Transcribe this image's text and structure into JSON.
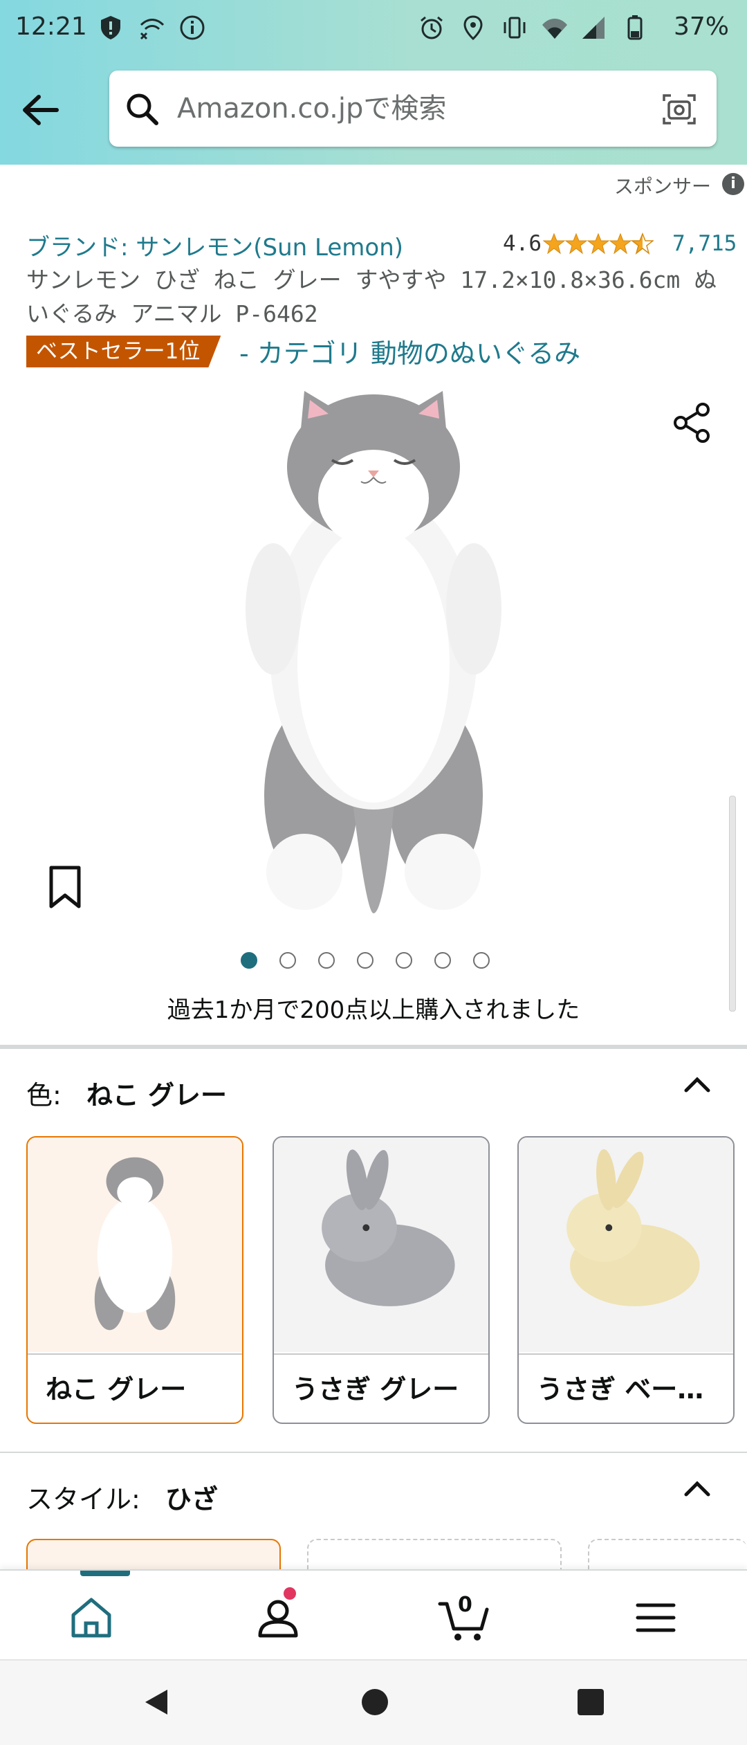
{
  "status_bar": {
    "time": "12:21",
    "battery": "37%"
  },
  "search": {
    "placeholder": "Amazon.co.jpで検索"
  },
  "sponsor": {
    "label": "スポンサー"
  },
  "product": {
    "brand": "ブランド: サンレモン(Sun Lemon)",
    "rating": "4.6",
    "rating_stars": 4.5,
    "rating_count": "7,715",
    "title": "サンレモン ひざ ねこ グレー すやすや 17.2×10.8×36.6cm ぬいぐるみ アニマル P-6462",
    "badge": "ベストセラー1位",
    "category": "- カテゴリ 動物のぬいぐるみ",
    "image_count": 7,
    "active_image": 1,
    "bought_text": "過去1か月で200点以上購入されました"
  },
  "color": {
    "label": "色:",
    "selected": "ねこ グレー",
    "options": [
      "ねこ グレー",
      "うさぎ グレー",
      "うさぎ ベー…"
    ]
  },
  "style": {
    "label": "スタイル:",
    "selected": "ひざ"
  },
  "bottom_nav": {
    "cart_count": "0"
  },
  "icons": [
    "back-arrow-icon",
    "search-icon",
    "camera-icon",
    "info-icon",
    "share-icon",
    "bookmark-icon",
    "chevron-up-icon",
    "home-icon",
    "account-icon",
    "cart-icon",
    "menu-icon",
    "nav-back-icon",
    "nav-home-icon",
    "nav-recents-icon"
  ],
  "colors": {
    "accent": "#1f7a8c",
    "badge": "#c45500",
    "selected_border": "#e77600"
  }
}
